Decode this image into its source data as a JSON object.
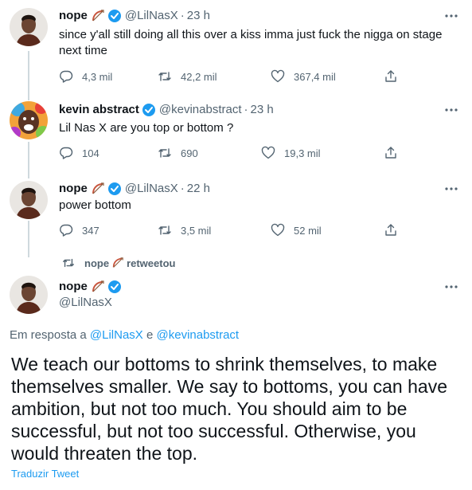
{
  "tweets": [
    {
      "name": "nope",
      "handle": "@LilNasX",
      "separator": "·",
      "time": "23 h",
      "text": "since y'all still doing all this over a kiss imma just fuck the nigga on stage next time",
      "replies": "4,3 mil",
      "retweets": "42,2 mil",
      "likes": "367,4 mil"
    },
    {
      "name": "kevin abstract",
      "handle": "@kevinabstract",
      "separator": "·",
      "time": "23 h",
      "text": "Lil Nas X are you top or bottom ?",
      "replies": "104",
      "retweets": "690",
      "likes": "19,3 mil"
    },
    {
      "name": "nope",
      "handle": "@LilNasX",
      "separator": "·",
      "time": "22 h",
      "text": "power bottom",
      "replies": "347",
      "retweets": "3,5 mil",
      "likes": "52 mil"
    }
  ],
  "retweet_banner": {
    "name": "nope",
    "label": "retweetou"
  },
  "main_tweet": {
    "name": "nope",
    "handle": "@LilNasX",
    "reply_prefix": "Em resposta a",
    "reply_user_1": "@LilNasX",
    "reply_connector": "e",
    "reply_user_2": "@kevinabstract",
    "text": "We teach our bottoms to shrink themselves, to make themselves smaller. We say to bottoms, you can have ambition, but not too much. You should aim to be successful, but not too successful. Otherwise, you would threaten the top.",
    "translate_label": "Traduzir Tweet"
  },
  "icons": {
    "reply": "reply-icon",
    "retweet": "retweet-icon",
    "like": "heart-icon",
    "share": "share-icon",
    "more": "more-icon",
    "verified": "verified-badge-icon",
    "emoji": "bow-and-arrow-emoji-icon"
  },
  "colors": {
    "accent": "#1d9bf0",
    "secondary_text": "#536471",
    "thread_line": "#cfd9de"
  }
}
